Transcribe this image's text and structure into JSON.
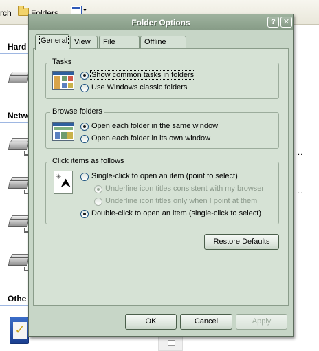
{
  "background": {
    "toolbar": {
      "search_label": "rch",
      "folders_label": "Folders"
    },
    "sections": [
      "Hard",
      "Netwo",
      "Othe"
    ],
    "ellipses": [
      "...",
      "..."
    ]
  },
  "dialog": {
    "title": "Folder Options",
    "title_buttons": {
      "help": "?",
      "close": "✕"
    },
    "tabs": [
      {
        "label": "General",
        "active": true
      },
      {
        "label": "View",
        "active": false
      },
      {
        "label": "File Types",
        "active": false
      },
      {
        "label": "Offline Files",
        "active": false
      }
    ],
    "groups": {
      "tasks": {
        "title": "Tasks",
        "options": [
          {
            "label": "Show common tasks in folders",
            "checked": true
          },
          {
            "label": "Use Windows classic folders",
            "checked": false
          }
        ]
      },
      "browse": {
        "title": "Browse folders",
        "options": [
          {
            "label": "Open each folder in the same window",
            "checked": true
          },
          {
            "label": "Open each folder in its own window",
            "checked": false
          }
        ]
      },
      "click": {
        "title": "Click items as follows",
        "options": [
          {
            "label": "Single-click to open an item (point to select)",
            "checked": false
          },
          {
            "label": "Underline icon titles consistent with my browser",
            "checked": true,
            "disabled": true
          },
          {
            "label": "Underline icon titles only when I point at them",
            "checked": false,
            "disabled": true
          },
          {
            "label": "Double-click to open an item (single-click to select)",
            "checked": true
          }
        ]
      }
    },
    "restore_defaults": "Restore Defaults",
    "buttons": {
      "ok": "OK",
      "cancel": "Cancel",
      "apply": "Apply"
    }
  }
}
